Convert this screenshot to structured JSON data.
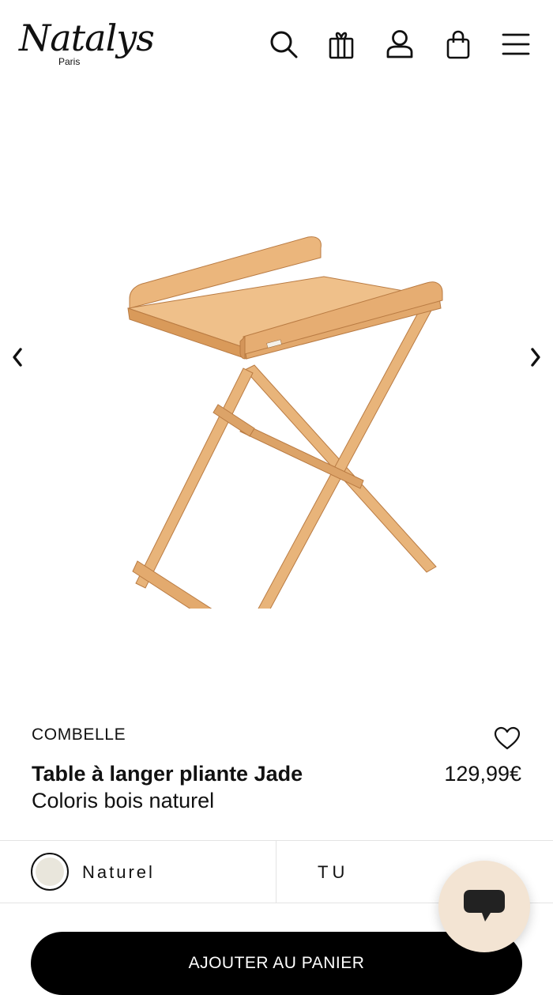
{
  "header": {
    "logo_text": "Natalys",
    "logo_subtext": "Paris",
    "icons": [
      "search-icon",
      "gift-icon",
      "user-icon",
      "bag-icon",
      "menu-icon"
    ]
  },
  "gallery": {
    "prev_icon": "chevron-left-icon",
    "next_icon": "chevron-right-icon",
    "image_subject": "folding wooden changing table"
  },
  "product": {
    "brand": "COMBELLE",
    "title": "Table à langer pliante Jade",
    "subtitle": "Coloris bois naturel",
    "price": "129,99€",
    "wishlist_icon": "heart-icon"
  },
  "options": {
    "color_label": "Naturel",
    "size_label": "TU"
  },
  "cta": {
    "add_to_cart_label": "AJOUTER AU PANIER"
  },
  "chat": {
    "icon": "chat-icon"
  },
  "colors": {
    "text": "#111111",
    "swatch_naturel": "#e9e6dc",
    "cta_background": "#000000",
    "chat_background": "#f3e4d3",
    "chat_icon": "#222222",
    "wood": "#e8b47a",
    "wood_dark": "#c98a4e",
    "divider": "#e3e3e3"
  }
}
